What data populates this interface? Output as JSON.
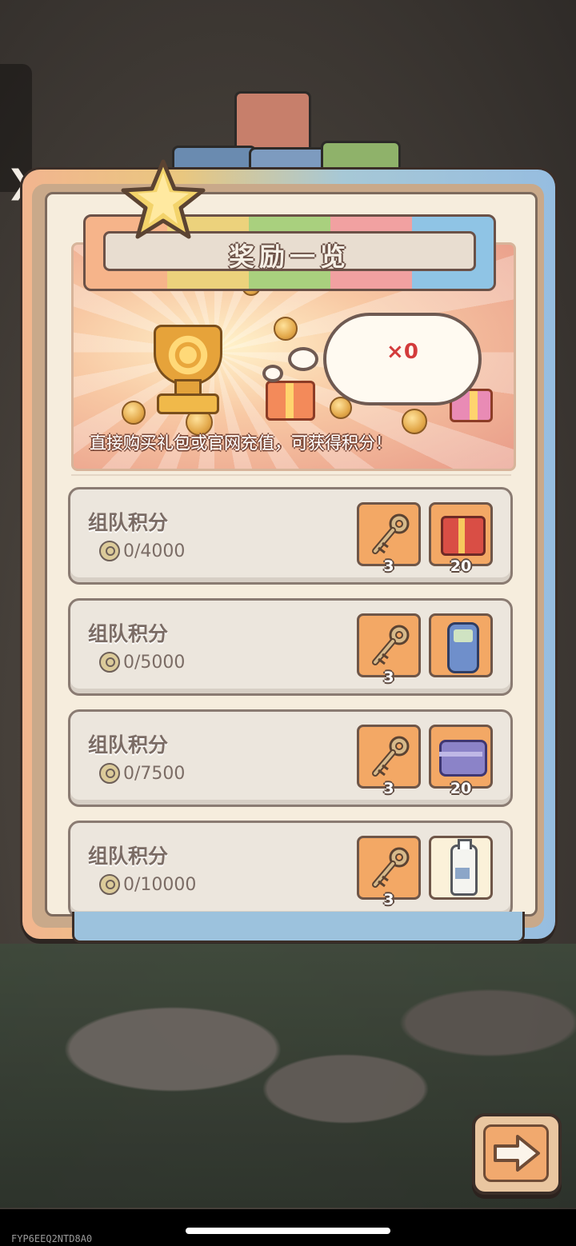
{
  "popup": {
    "title": "奖励一览",
    "banner": {
      "bubble_count": "×0",
      "note": "直接购买礼包或官网充值，可获得积分！"
    }
  },
  "tiers": [
    {
      "title": "组队积分",
      "progress": "0/4000",
      "rewards": [
        {
          "icon": "key-icon",
          "count": "3"
        },
        {
          "icon": "gift-box-icon",
          "count": "20"
        }
      ]
    },
    {
      "title": "组队积分",
      "progress": "0/5000",
      "rewards": [
        {
          "icon": "key-icon",
          "count": "3"
        },
        {
          "icon": "phone-icon",
          "count": ""
        }
      ]
    },
    {
      "title": "组队积分",
      "progress": "0/7500",
      "rewards": [
        {
          "icon": "key-icon",
          "count": "3"
        },
        {
          "icon": "treasure-chest-icon",
          "count": "20"
        }
      ]
    },
    {
      "title": "组队积分",
      "progress": "0/10000",
      "rewards": [
        {
          "icon": "key-icon",
          "count": "3"
        },
        {
          "icon": "bottle-icon",
          "count": ""
        }
      ]
    }
  ],
  "side_tab": {
    "glyph": "❯"
  },
  "build_tag": "FYP6EEQ2NTD8A0",
  "colors": {
    "accent_orange": "#f3a865",
    "panel_bg": "#f6eddd",
    "count_red": "#d33b3b"
  }
}
